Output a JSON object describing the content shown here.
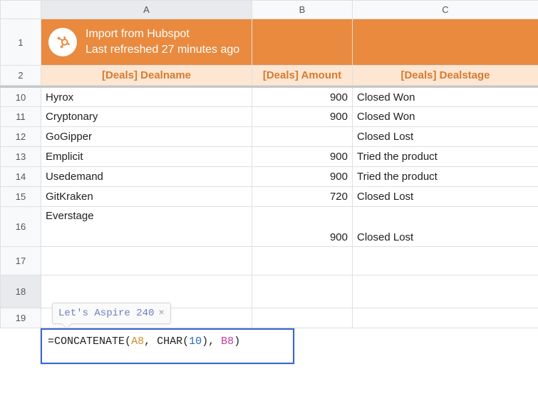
{
  "columns": {
    "A": "A",
    "B": "B",
    "C": "C"
  },
  "banner": {
    "title": "Import from Hubspot",
    "subtitle": "Last refreshed 27 minutes ago"
  },
  "headers": {
    "A": "[Deals] Dealname",
    "B": "[Deals] Amount",
    "C": "[Deals] Dealstage"
  },
  "rownums": {
    "r1": "1",
    "r2": "2",
    "r10": "10",
    "r11": "11",
    "r12": "12",
    "r13": "13",
    "r14": "14",
    "r15": "15",
    "r16": "16",
    "r17": "17",
    "r18": "18",
    "r19": "19"
  },
  "rows": {
    "r10": {
      "A": "Hyrox",
      "B": "900",
      "C": "Closed Won"
    },
    "r11": {
      "A": "Cryptonary",
      "B": "900",
      "C": "Closed Won"
    },
    "r12": {
      "A": "GoGipper",
      "B": "",
      "C": "Closed Lost"
    },
    "r13": {
      "A": "Emplicit",
      "B": "900",
      "C": "Tried the product"
    },
    "r14": {
      "A": "Usedemand",
      "B": "900",
      "C": "Tried the product"
    },
    "r15": {
      "A": "GitKraken",
      "B": "720",
      "C": "Closed Lost"
    },
    "r16": {
      "A": "Everstage",
      "B": "900",
      "C": "Closed Lost"
    },
    "r17": {
      "A": "",
      "B": "",
      "C": ""
    },
    "r19": {
      "A": "",
      "B": "",
      "C": ""
    }
  },
  "tooltip": {
    "text": "Let's Aspire 240",
    "close": "×"
  },
  "formula": {
    "eq": "=",
    "fn1": "CONCATENATE",
    "p1": "(",
    "refA": "A8",
    "c1": ", ",
    "fn2": "CHAR",
    "p2": "(",
    "num": "10",
    "p3": ")",
    "c2": ", ",
    "refB": "B8",
    "p4": ")"
  }
}
